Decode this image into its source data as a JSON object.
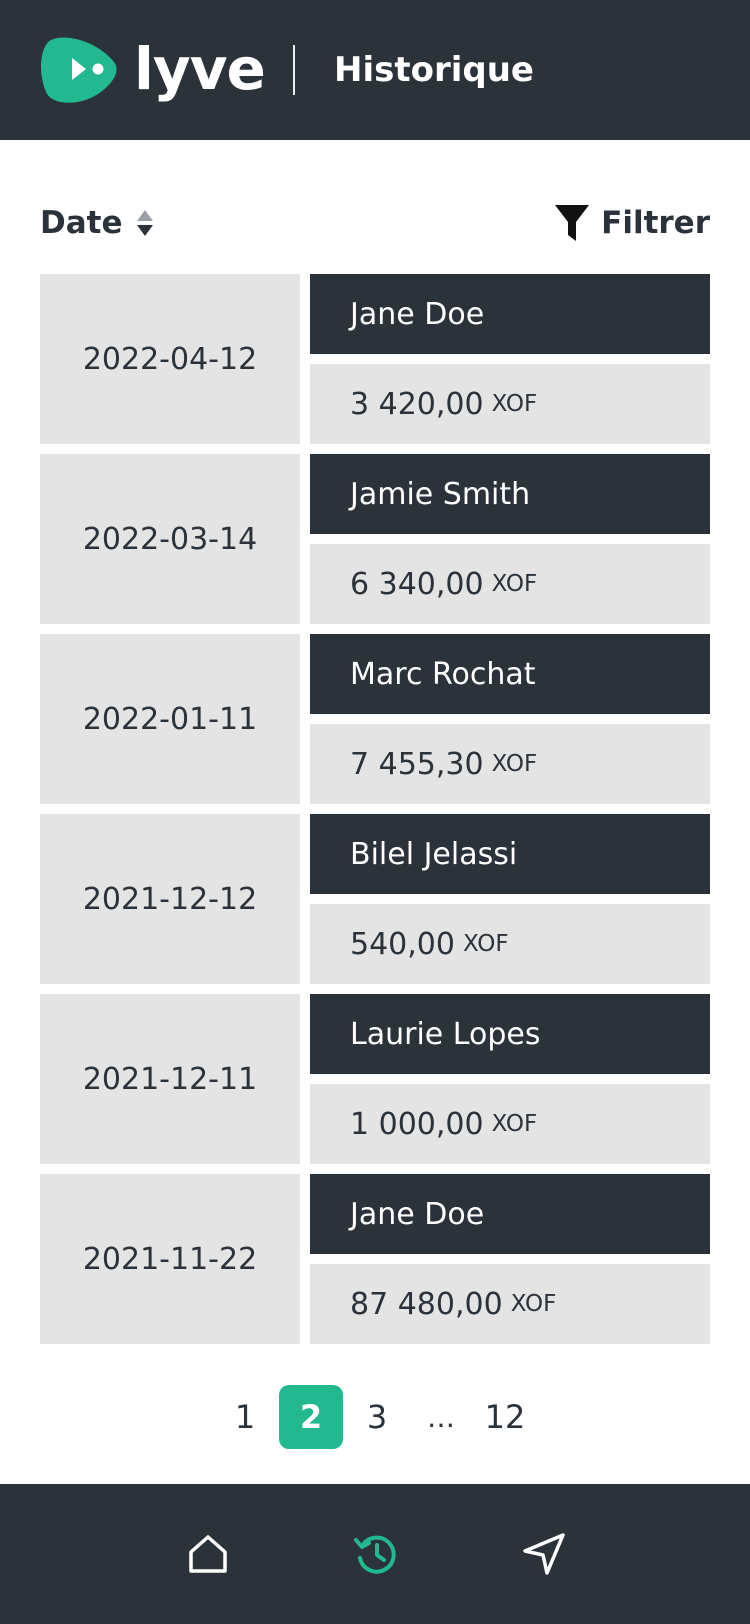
{
  "app": {
    "logo_text": "lyve",
    "page_title": "Historique"
  },
  "colors": {
    "dark": "#2b3239",
    "accent": "#22b890",
    "cell_bg": "#e4e4e4"
  },
  "toolbar": {
    "sort_label": "Date",
    "sort_icon": "sort-icon",
    "filter_label": "Filtrer",
    "filter_icon": "funnel-icon"
  },
  "transactions": [
    {
      "date": "2022-04-12",
      "name": "Jane Doe",
      "amount": "3 420,00",
      "currency": "XOF"
    },
    {
      "date": "2022-03-14",
      "name": "Jamie Smith",
      "amount": "6 340,00",
      "currency": "XOF"
    },
    {
      "date": "2022-01-11",
      "name": "Marc Rochat",
      "amount": "7 455,30",
      "currency": "XOF"
    },
    {
      "date": "2021-12-12",
      "name": "Bilel Jelassi",
      "amount": "540,00",
      "currency": "XOF"
    },
    {
      "date": "2021-12-11",
      "name": "Laurie Lopes",
      "amount": "1 000,00",
      "currency": "XOF"
    },
    {
      "date": "2021-11-22",
      "name": "Jane Doe",
      "amount": "87 480,00",
      "currency": "XOF"
    }
  ],
  "pagination": {
    "pages": [
      "1",
      "2",
      "3",
      "…",
      "12"
    ],
    "current": "2"
  },
  "bottom_nav": {
    "items": [
      {
        "icon": "home-icon",
        "active": false
      },
      {
        "icon": "history-icon",
        "active": true
      },
      {
        "icon": "send-icon",
        "active": false
      }
    ]
  }
}
